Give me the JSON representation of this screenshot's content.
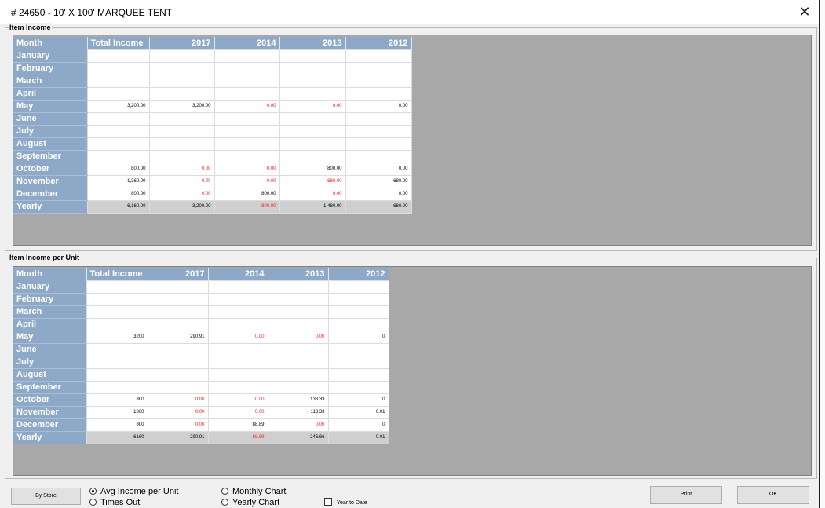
{
  "window": {
    "title": "# 24650 - 10' X 100' MARQUEE TENT",
    "close_glyph": "✕"
  },
  "income_group": {
    "label": "Item Income",
    "columns": [
      "Month",
      "Total Income",
      "2017",
      "2014",
      "2013",
      "2012"
    ],
    "rows": [
      {
        "month": "January",
        "values": [
          "",
          "",
          "",
          "",
          ""
        ],
        "negative": [
          false,
          false,
          false,
          false,
          false
        ]
      },
      {
        "month": "February",
        "values": [
          "",
          "",
          "",
          "",
          ""
        ],
        "negative": [
          false,
          false,
          false,
          false,
          false
        ]
      },
      {
        "month": "March",
        "values": [
          "",
          "",
          "",
          "",
          ""
        ],
        "negative": [
          false,
          false,
          false,
          false,
          false
        ]
      },
      {
        "month": "April",
        "values": [
          "",
          "",
          "",
          "",
          ""
        ],
        "negative": [
          false,
          false,
          false,
          false,
          false
        ]
      },
      {
        "month": "May",
        "values": [
          "3,200.00",
          "3,200.00",
          "0.00",
          "0.00",
          "0.00"
        ],
        "negative": [
          false,
          false,
          true,
          true,
          false
        ]
      },
      {
        "month": "June",
        "values": [
          "",
          "",
          "",
          "",
          ""
        ],
        "negative": [
          false,
          false,
          false,
          false,
          false
        ]
      },
      {
        "month": "July",
        "values": [
          "",
          "",
          "",
          "",
          ""
        ],
        "negative": [
          false,
          false,
          false,
          false,
          false
        ]
      },
      {
        "month": "August",
        "values": [
          "",
          "",
          "",
          "",
          ""
        ],
        "negative": [
          false,
          false,
          false,
          false,
          false
        ]
      },
      {
        "month": "September",
        "values": [
          "",
          "",
          "",
          "",
          ""
        ],
        "negative": [
          false,
          false,
          false,
          false,
          false
        ]
      },
      {
        "month": "October",
        "values": [
          "800.00",
          "0.00",
          "0.00",
          "800.00",
          "0.00"
        ],
        "negative": [
          false,
          true,
          true,
          false,
          false
        ]
      },
      {
        "month": "November",
        "values": [
          "1,360.00",
          "0.00",
          "0.00",
          "680.00",
          "680.00"
        ],
        "negative": [
          false,
          true,
          true,
          true,
          false
        ]
      },
      {
        "month": "December",
        "values": [
          "800.00",
          "0.00",
          "800.00",
          "0.00",
          "0.00"
        ],
        "negative": [
          false,
          true,
          false,
          true,
          false
        ]
      },
      {
        "month": "Yearly",
        "values": [
          "6,160.00",
          "3,200.00",
          "800.00",
          "1,480.00",
          "680.00"
        ],
        "negative": [
          false,
          false,
          true,
          false,
          false
        ]
      }
    ]
  },
  "per_unit_group": {
    "label": "Item Income per Unit",
    "columns": [
      "Month",
      "Total Income",
      "2017",
      "2014",
      "2013",
      "2012"
    ],
    "rows": [
      {
        "month": "January",
        "values": [
          "",
          "",
          "",
          "",
          ""
        ],
        "negative": [
          false,
          false,
          false,
          false,
          false
        ]
      },
      {
        "month": "February",
        "values": [
          "",
          "",
          "",
          "",
          ""
        ],
        "negative": [
          false,
          false,
          false,
          false,
          false
        ]
      },
      {
        "month": "March",
        "values": [
          "",
          "",
          "",
          "",
          ""
        ],
        "negative": [
          false,
          false,
          false,
          false,
          false
        ]
      },
      {
        "month": "April",
        "values": [
          "",
          "",
          "",
          "",
          ""
        ],
        "negative": [
          false,
          false,
          false,
          false,
          false
        ]
      },
      {
        "month": "May",
        "values": [
          "3200",
          "290.91",
          "0.00",
          "0.00",
          "0"
        ],
        "negative": [
          false,
          false,
          true,
          true,
          false
        ]
      },
      {
        "month": "June",
        "values": [
          "",
          "",
          "",
          "",
          ""
        ],
        "negative": [
          false,
          false,
          false,
          false,
          false
        ]
      },
      {
        "month": "July",
        "values": [
          "",
          "",
          "",
          "",
          ""
        ],
        "negative": [
          false,
          false,
          false,
          false,
          false
        ]
      },
      {
        "month": "August",
        "values": [
          "",
          "",
          "",
          "",
          ""
        ],
        "negative": [
          false,
          false,
          false,
          false,
          false
        ]
      },
      {
        "month": "September",
        "values": [
          "",
          "",
          "",
          "",
          ""
        ],
        "negative": [
          false,
          false,
          false,
          false,
          false
        ]
      },
      {
        "month": "October",
        "values": [
          "800",
          "0.00",
          "0.00",
          "133.33",
          "0"
        ],
        "negative": [
          false,
          true,
          true,
          false,
          false
        ]
      },
      {
        "month": "November",
        "values": [
          "1360",
          "0.00",
          "0.00",
          "113.33",
          "0.01"
        ],
        "negative": [
          false,
          true,
          true,
          false,
          false
        ]
      },
      {
        "month": "December",
        "values": [
          "800",
          "0.00",
          "88.89",
          "0.00",
          "0"
        ],
        "negative": [
          false,
          true,
          false,
          true,
          false
        ]
      },
      {
        "month": "Yearly",
        "values": [
          "6160",
          "290.91",
          "88.89",
          "246.66",
          "0.01"
        ],
        "negative": [
          false,
          false,
          true,
          false,
          false
        ]
      }
    ]
  },
  "footer": {
    "by_store_label": "By Store",
    "radio_avg_income": "Avg Income per Unit",
    "radio_times_out": "Times Out",
    "radio_monthly_chart": "Monthly Chart",
    "radio_yearly_chart": "Yearly Chart",
    "selected_radio": "Avg Income per Unit",
    "year_to_date_label": "Year to Date",
    "year_to_date_checked": false,
    "print_label": "Print",
    "ok_label": "OK"
  },
  "colors": {
    "header_blue": "#8ea9c8",
    "negative_red": "#ff1a1a",
    "panel_gray": "#a8a8a8",
    "yearly_row": "#cfcfcf"
  }
}
